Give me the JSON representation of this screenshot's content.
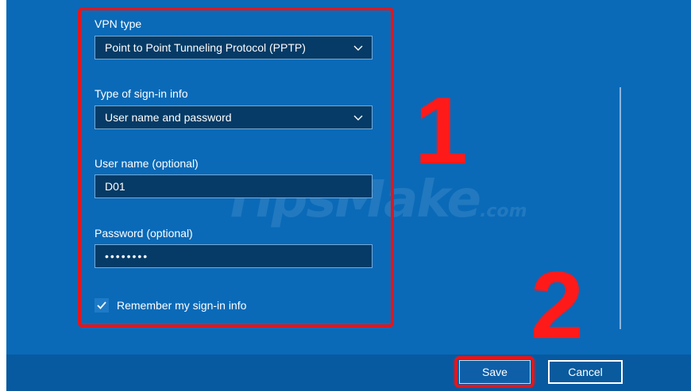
{
  "form": {
    "vpn_type_label": "VPN type",
    "vpn_type_value": "Point to Point Tunneling Protocol (PPTP)",
    "signin_type_label": "Type of sign-in info",
    "signin_type_value": "User name and password",
    "username_label": "User name (optional)",
    "username_value": "D01",
    "password_label": "Password (optional)",
    "password_value": "••••••••",
    "remember_label": "Remember my sign-in info",
    "remember_checked": true
  },
  "annotations": {
    "step1": "1",
    "step2": "2"
  },
  "buttons": {
    "save": "Save",
    "cancel": "Cancel"
  },
  "watermark": {
    "brand": "TipsMake",
    "suffix": ".com"
  },
  "colors": {
    "background": "#0a6ab8",
    "field": "#053b66",
    "highlight": "#e5151a"
  }
}
